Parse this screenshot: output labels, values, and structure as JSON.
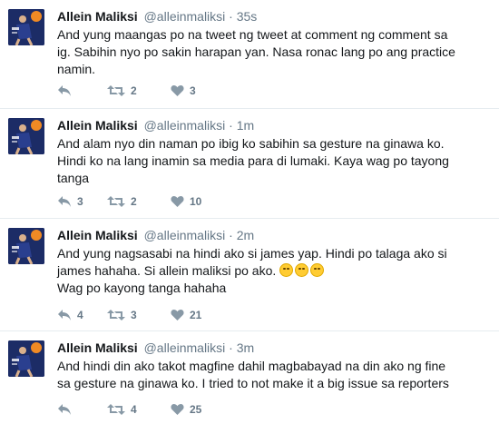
{
  "tweets": [
    {
      "name": "Allein Maliksi",
      "handle": "@alleinmaliksi",
      "separator": "·",
      "time": "35s",
      "lines": [
        "And yung maangas po na tweet ng tweet at comment ng comment sa",
        "ig. Sabihin nyo po sakin harapan yan. Nasa ronac lang po ang practice",
        "namin."
      ],
      "reply_count": "",
      "retweet_count": "2",
      "like_count": "3"
    },
    {
      "name": "Allein Maliksi",
      "handle": "@alleinmaliksi",
      "separator": "·",
      "time": "1m",
      "lines": [
        "And alam nyo din naman po ibig ko sabihin sa gesture na ginawa ko.",
        "Hindi ko na lang inamin sa media para di lumaki. Kaya wag po tayong",
        "tanga"
      ],
      "reply_count": "3",
      "retweet_count": "2",
      "like_count": "10"
    },
    {
      "name": "Allein Maliksi",
      "handle": "@alleinmaliksi",
      "separator": "·",
      "time": "2m",
      "lines": [
        "And yung nagsasabi na hindi ako si james yap. Hindi po talaga ako si",
        "james hahaha. Si allein maliksi po ako.",
        "Wag po kayong tanga hahaha"
      ],
      "reply_count": "4",
      "retweet_count": "3",
      "like_count": "21"
    },
    {
      "name": "Allein Maliksi",
      "handle": "@alleinmaliksi",
      "separator": "·",
      "time": "3m",
      "lines": [
        "And hindi din ako takot magfine dahil magbabayad na din ako ng fine",
        "sa gesture na ginawa ko. I tried to not make it a big issue sa reporters"
      ],
      "reply_count": "",
      "retweet_count": "4",
      "like_count": "25"
    }
  ],
  "icons": {
    "reply": "reply-icon",
    "retweet": "retweet-icon",
    "like": "heart-icon",
    "emoji": "rofl-emoji"
  },
  "colors": {
    "text": "#14171a",
    "secondary": "#657786",
    "divider": "#e6ecf0",
    "avatar_bg": "#1c2c66"
  }
}
